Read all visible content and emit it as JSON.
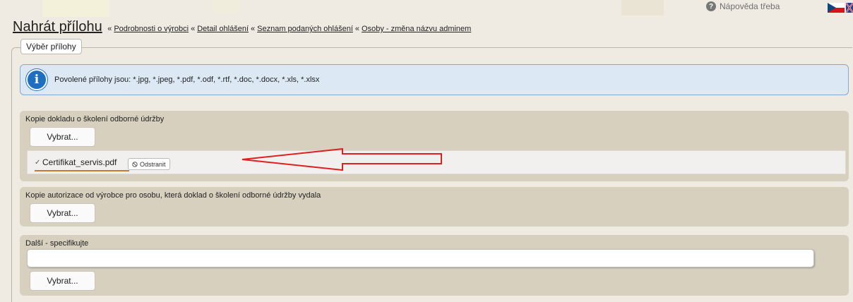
{
  "header": {
    "help_label": "Nápověda třeba",
    "help_icon": "question-icon",
    "flag_icon": "czech-flag-icon",
    "title": "Nahrát přílohu",
    "breadcrumb_separator": "«",
    "breadcrumbs": [
      "Podrobnosti o výrobci",
      "Detail ohlášení",
      "Seznam podaných ohlášení",
      "Osoby - změna názvu adminem"
    ]
  },
  "tab": {
    "label": "Výběr přílohy"
  },
  "info": {
    "icon": "info-icon",
    "text": "Povolené přílohy jsou: *.jpg, *.jpeg, *.pdf, *.odf, *.rtf, *.doc, *.docx, *.xls, *.xlsx"
  },
  "sections": [
    {
      "label": "Kopie dokladu o školení odborné údržby",
      "button": "Vybrat...",
      "file": {
        "check": "✓",
        "name": "Certifikat_servis.pdf",
        "remove_label": "Odstranit"
      }
    },
    {
      "label": "Kopie autorizace od výrobce pro osobu, která doklad o školení odborné údržby vydala",
      "button": "Vybrat..."
    },
    {
      "label": "Další - specifikujte",
      "input_value": "",
      "button": "Vybrat..."
    }
  ],
  "colors": {
    "page_bg": "#efebe2",
    "section_bg": "#d7d0bf",
    "info_bg": "#dce9f5",
    "info_border": "#84a8d0",
    "arrow": "#e02020",
    "file_underline": "#c9792f"
  }
}
